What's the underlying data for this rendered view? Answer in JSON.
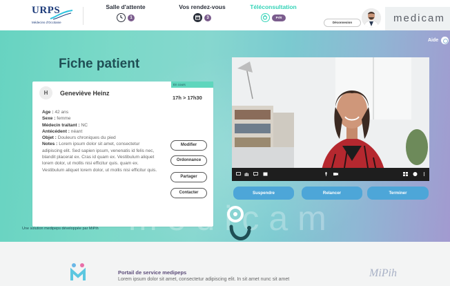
{
  "header": {
    "logo": {
      "name": "URPS",
      "subtitle": "Médecins d'Occitanie"
    },
    "nav": [
      {
        "label": "Salle d'attente",
        "badge": "1",
        "icon": "clock-icon"
      },
      {
        "label": "Vos rendez-vous",
        "badge": "3",
        "icon": "calendar-icon"
      },
      {
        "label": "Téléconsultation",
        "badge": "Prêt",
        "icon": "power-icon"
      }
    ],
    "logout_label": "Déconnexion",
    "brand": "medicam"
  },
  "help_label": "Aide",
  "page_title": "Fiche patient",
  "patient": {
    "initial": "H",
    "name": "Geneviève Heinz",
    "status": "En cours",
    "time": "17h > 17h30",
    "fields": [
      {
        "key": "Age :",
        "value": "42 ans"
      },
      {
        "key": "Sexe :",
        "value": "femme"
      },
      {
        "key": "Médecin traitant :",
        "value": "NC"
      },
      {
        "key": "Antécédent :",
        "value": "néant"
      },
      {
        "key": "Objet :",
        "value": "Douleurs chroniques du pied"
      }
    ],
    "notes_key": "Notes :",
    "notes": "Lorem ipsum dolor sit amet, consectetur adipiscing elit. Sed sapien ipsum, venenatis id felis nec, blandit placerat ex. Cras id quam ex. Vestibulum aliquet lorem dolor, ut mollis nisi efficitur quis. quam ex. Vestibulum aliquet lorem dolor, ut mollis nisi efficitur quis."
  },
  "actions": [
    "Modifier",
    "Ordonnance",
    "Partager",
    "Contacter"
  ],
  "video_controls": [
    "Suspendre",
    "Relancer",
    "Terminer"
  ],
  "credit": "Une solution medipeps développée par MiPih",
  "watermark": "medicam",
  "footer": {
    "title": "Portail de service medipeps",
    "text": "Lorem ipsum dolor sit amet, consectetur adipiscing elit. In sit amet nunc sit amet",
    "partner": "MiPih"
  },
  "colors": {
    "teal": "#34d3b7",
    "navy": "#1f4f55",
    "purple": "#7b5c8d",
    "button_blue": "#4da6d8"
  }
}
